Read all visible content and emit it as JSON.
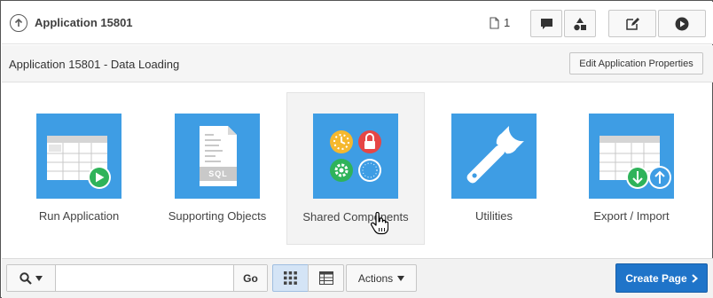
{
  "topbar": {
    "app_title": "Application 15801",
    "page_count": "1",
    "icons": [
      "up-arrow-icon",
      "page-icon",
      "comment-icon",
      "shapes-icon",
      "edit-icon",
      "run-icon"
    ]
  },
  "header": {
    "title": "Application 15801 - Data Loading",
    "edit_button_label": "Edit Application Properties"
  },
  "tiles": [
    {
      "label": "Run Application",
      "icon": "run-application-icon"
    },
    {
      "label": "Supporting Objects",
      "icon": "supporting-objects-icon",
      "badge_text": "SQL"
    },
    {
      "label": "Shared Components",
      "icon": "shared-components-icon"
    },
    {
      "label": "Utilities",
      "icon": "wrench-icon"
    },
    {
      "label": "Export / Import",
      "icon": "export-import-icon"
    }
  ],
  "toolbar": {
    "search_placeholder": "",
    "search_value": "",
    "go_label": "Go",
    "actions_label": "Actions",
    "create_page_label": "Create Page",
    "active_view": "icons"
  },
  "colors": {
    "tile_blue": "#3e9de4",
    "primary_button": "#1f74c9",
    "green_badge": "#2fb35a",
    "hover_tile_bg": "#f3f3f3"
  }
}
